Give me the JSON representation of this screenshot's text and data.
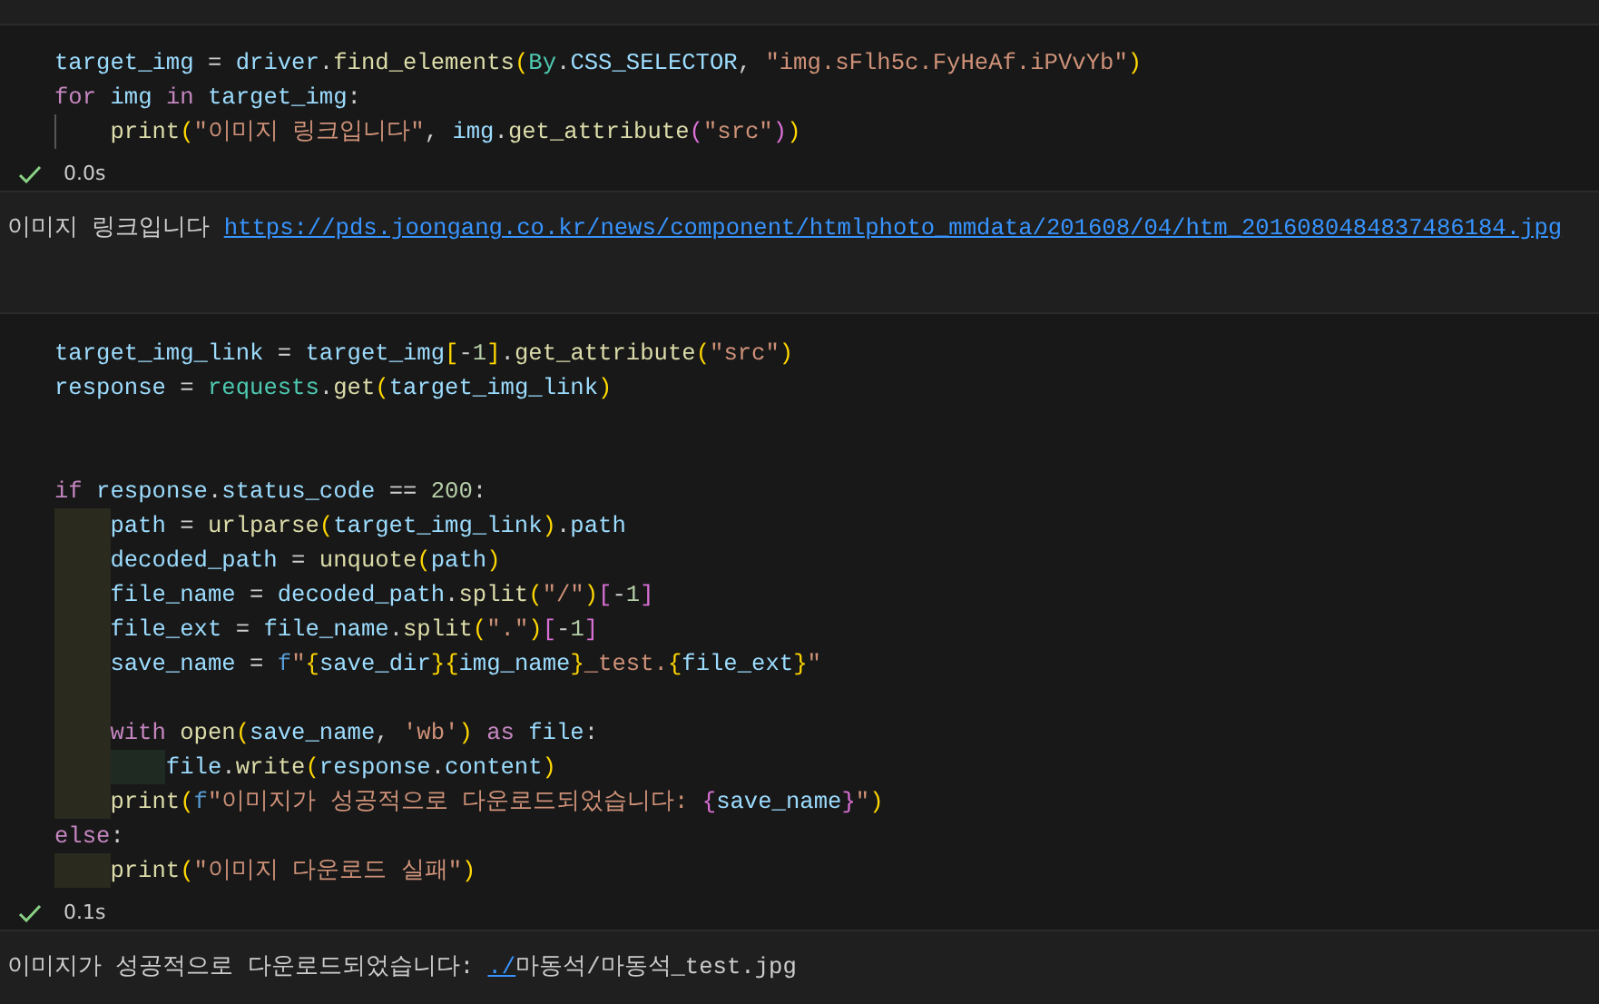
{
  "cells": [
    {
      "code": [
        {
          "kind": "code",
          "tokens": [
            {
              "kind": "var",
              "text": "target_img"
            },
            {
              "kind": "op",
              "text": " = "
            },
            {
              "kind": "var",
              "text": "driver"
            },
            {
              "kind": "op",
              "text": "."
            },
            {
              "kind": "fn",
              "text": "find_elements"
            },
            {
              "kind": "br",
              "text": "("
            },
            {
              "kind": "cls",
              "text": "By"
            },
            {
              "kind": "op",
              "text": "."
            },
            {
              "kind": "var",
              "text": "CSS_SELECTOR"
            },
            {
              "kind": "op",
              "text": ", "
            },
            {
              "kind": "str",
              "text": "\"img.sFlh5c.FyHeAf.iPVvYb\""
            },
            {
              "kind": "br",
              "text": ")"
            }
          ]
        },
        {
          "kind": "code",
          "tokens": [
            {
              "kind": "kw",
              "text": "for "
            },
            {
              "kind": "var",
              "text": "img "
            },
            {
              "kind": "kw",
              "text": "in "
            },
            {
              "kind": "var",
              "text": "target_img"
            },
            {
              "kind": "op",
              "text": ":"
            }
          ]
        },
        {
          "kind": "code",
          "guides": [
            {
              "kind": "line"
            }
          ],
          "tokens": [
            {
              "kind": "fn",
              "text": "print"
            },
            {
              "kind": "br",
              "text": "("
            },
            {
              "kind": "str",
              "text": "\"이미지 링크입니다\""
            },
            {
              "kind": "op",
              "text": ", "
            },
            {
              "kind": "var",
              "text": "img"
            },
            {
              "kind": "op",
              "text": "."
            },
            {
              "kind": "fn",
              "text": "get_attribute"
            },
            {
              "kind": "br2",
              "text": "("
            },
            {
              "kind": "str",
              "text": "\"src\""
            },
            {
              "kind": "br2",
              "text": ")"
            },
            {
              "kind": "br",
              "text": ")"
            }
          ]
        }
      ],
      "status": {
        "success": true,
        "time": "0.0s"
      },
      "output": [
        {
          "kind": "text",
          "text": "이미지 링크입니다 "
        },
        {
          "kind": "link",
          "text": "https://pds.joongang.co.kr/news/component/htmlphoto_mmdata/201608/04/htm_2016080484837486184.jpg"
        }
      ]
    },
    {
      "code": [
        {
          "kind": "code",
          "tokens": [
            {
              "kind": "var",
              "text": "target_img_link"
            },
            {
              "kind": "op",
              "text": " = "
            },
            {
              "kind": "var",
              "text": "target_img"
            },
            {
              "kind": "br",
              "text": "["
            },
            {
              "kind": "op",
              "text": "-"
            },
            {
              "kind": "num",
              "text": "1"
            },
            {
              "kind": "br",
              "text": "]"
            },
            {
              "kind": "op",
              "text": "."
            },
            {
              "kind": "fn",
              "text": "get_attribute"
            },
            {
              "kind": "br",
              "text": "("
            },
            {
              "kind": "str",
              "text": "\"src\""
            },
            {
              "kind": "br",
              "text": ")"
            }
          ]
        },
        {
          "kind": "code",
          "tokens": [
            {
              "kind": "var",
              "text": "response"
            },
            {
              "kind": "op",
              "text": " = "
            },
            {
              "kind": "cls",
              "text": "requests"
            },
            {
              "kind": "op",
              "text": "."
            },
            {
              "kind": "fn",
              "text": "get"
            },
            {
              "kind": "br",
              "text": "("
            },
            {
              "kind": "var",
              "text": "target_img_link"
            },
            {
              "kind": "br",
              "text": ")"
            }
          ]
        },
        {
          "kind": "blank"
        },
        {
          "kind": "blank"
        },
        {
          "kind": "code",
          "tokens": [
            {
              "kind": "kw",
              "text": "if "
            },
            {
              "kind": "var",
              "text": "response"
            },
            {
              "kind": "op",
              "text": "."
            },
            {
              "kind": "var",
              "text": "status_code"
            },
            {
              "kind": "op",
              "text": " == "
            },
            {
              "kind": "num",
              "text": "200"
            },
            {
              "kind": "op",
              "text": ":"
            }
          ]
        },
        {
          "kind": "code",
          "guides": [
            {
              "kind": "block"
            }
          ],
          "tokens": [
            {
              "kind": "var",
              "text": "path"
            },
            {
              "kind": "op",
              "text": " = "
            },
            {
              "kind": "fn",
              "text": "urlparse"
            },
            {
              "kind": "br",
              "text": "("
            },
            {
              "kind": "var",
              "text": "target_img_link"
            },
            {
              "kind": "br",
              "text": ")"
            },
            {
              "kind": "op",
              "text": "."
            },
            {
              "kind": "var",
              "text": "path"
            }
          ]
        },
        {
          "kind": "code",
          "guides": [
            {
              "kind": "block"
            }
          ],
          "tokens": [
            {
              "kind": "var",
              "text": "decoded_path"
            },
            {
              "kind": "op",
              "text": " = "
            },
            {
              "kind": "fn",
              "text": "unquote"
            },
            {
              "kind": "br",
              "text": "("
            },
            {
              "kind": "var",
              "text": "path"
            },
            {
              "kind": "br",
              "text": ")"
            }
          ]
        },
        {
          "kind": "code",
          "guides": [
            {
              "kind": "block"
            }
          ],
          "tokens": [
            {
              "kind": "var",
              "text": "file_name"
            },
            {
              "kind": "op",
              "text": " = "
            },
            {
              "kind": "var",
              "text": "decoded_path"
            },
            {
              "kind": "op",
              "text": "."
            },
            {
              "kind": "fn",
              "text": "split"
            },
            {
              "kind": "br",
              "text": "("
            },
            {
              "kind": "str",
              "text": "\"/\""
            },
            {
              "kind": "br",
              "text": ")"
            },
            {
              "kind": "br2",
              "text": "["
            },
            {
              "kind": "op",
              "text": "-"
            },
            {
              "kind": "num",
              "text": "1"
            },
            {
              "kind": "br2",
              "text": "]"
            }
          ]
        },
        {
          "kind": "code",
          "guides": [
            {
              "kind": "block"
            }
          ],
          "tokens": [
            {
              "kind": "var",
              "text": "file_ext"
            },
            {
              "kind": "op",
              "text": " = "
            },
            {
              "kind": "var",
              "text": "file_name"
            },
            {
              "kind": "op",
              "text": "."
            },
            {
              "kind": "fn",
              "text": "split"
            },
            {
              "kind": "br",
              "text": "("
            },
            {
              "kind": "str",
              "text": "\".\""
            },
            {
              "kind": "br",
              "text": ")"
            },
            {
              "kind": "br2",
              "text": "["
            },
            {
              "kind": "op",
              "text": "-"
            },
            {
              "kind": "num",
              "text": "1"
            },
            {
              "kind": "br2",
              "text": "]"
            }
          ]
        },
        {
          "kind": "code",
          "guides": [
            {
              "kind": "block"
            }
          ],
          "tokens": [
            {
              "kind": "var",
              "text": "save_name"
            },
            {
              "kind": "op",
              "text": " = "
            },
            {
              "kind": "kwb",
              "text": "f"
            },
            {
              "kind": "str",
              "text": "\""
            },
            {
              "kind": "br",
              "text": "{"
            },
            {
              "kind": "var",
              "text": "save_dir"
            },
            {
              "kind": "br",
              "text": "}"
            },
            {
              "kind": "br",
              "text": "{"
            },
            {
              "kind": "var",
              "text": "img_name"
            },
            {
              "kind": "br",
              "text": "}"
            },
            {
              "kind": "str",
              "text": "_test."
            },
            {
              "kind": "br",
              "text": "{"
            },
            {
              "kind": "var",
              "text": "file_ext"
            },
            {
              "kind": "br",
              "text": "}"
            },
            {
              "kind": "str",
              "text": "\""
            }
          ]
        },
        {
          "kind": "blank",
          "guides": [
            {
              "kind": "block"
            }
          ]
        },
        {
          "kind": "code",
          "guides": [
            {
              "kind": "block"
            }
          ],
          "tokens": [
            {
              "kind": "kw",
              "text": "with "
            },
            {
              "kind": "fn",
              "text": "open"
            },
            {
              "kind": "br",
              "text": "("
            },
            {
              "kind": "var",
              "text": "save_name"
            },
            {
              "kind": "op",
              "text": ", "
            },
            {
              "kind": "str",
              "text": "'wb'"
            },
            {
              "kind": "br",
              "text": ")"
            },
            {
              "kind": "kw",
              "text": " as "
            },
            {
              "kind": "var",
              "text": "file"
            },
            {
              "kind": "op",
              "text": ":"
            }
          ]
        },
        {
          "kind": "code",
          "guides": [
            {
              "kind": "block"
            },
            {
              "kind": "nested"
            }
          ],
          "tokens": [
            {
              "kind": "var",
              "text": "file"
            },
            {
              "kind": "op",
              "text": "."
            },
            {
              "kind": "fn",
              "text": "write"
            },
            {
              "kind": "br",
              "text": "("
            },
            {
              "kind": "var",
              "text": "response"
            },
            {
              "kind": "op",
              "text": "."
            },
            {
              "kind": "var",
              "text": "content"
            },
            {
              "kind": "br",
              "text": ")"
            }
          ]
        },
        {
          "kind": "code",
          "guides": [
            {
              "kind": "block"
            }
          ],
          "tokens": [
            {
              "kind": "fn",
              "text": "print"
            },
            {
              "kind": "br",
              "text": "("
            },
            {
              "kind": "kwb",
              "text": "f"
            },
            {
              "kind": "str",
              "text": "\"이미지가 성공적으로 다운로드되었습니다: "
            },
            {
              "kind": "br2",
              "text": "{"
            },
            {
              "kind": "var",
              "text": "save_name"
            },
            {
              "kind": "br2",
              "text": "}"
            },
            {
              "kind": "str",
              "text": "\""
            },
            {
              "kind": "br",
              "text": ")"
            }
          ]
        },
        {
          "kind": "code",
          "tokens": [
            {
              "kind": "kw",
              "text": "else"
            },
            {
              "kind": "op",
              "text": ":"
            }
          ]
        },
        {
          "kind": "code",
          "guides": [
            {
              "kind": "block"
            }
          ],
          "tokens": [
            {
              "kind": "fn",
              "text": "print"
            },
            {
              "kind": "br",
              "text": "("
            },
            {
              "kind": "str",
              "text": "\"이미지 다운로드 실패\""
            },
            {
              "kind": "br",
              "text": ")"
            }
          ]
        }
      ],
      "status": {
        "success": true,
        "time": "0.1s"
      },
      "output": [
        {
          "kind": "text",
          "text": "이미지가 성공적으로 다운로드되었습니다: "
        },
        {
          "kind": "link",
          "text": "./"
        },
        {
          "kind": "text",
          "text": "마동석/마동석_test.jpg"
        }
      ]
    }
  ]
}
